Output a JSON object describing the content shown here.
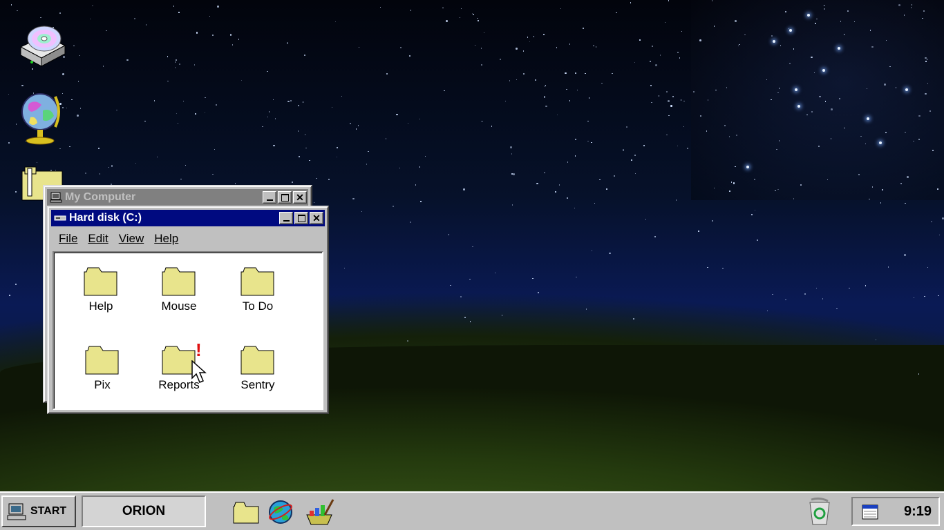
{
  "desktop": {
    "icons": [
      "cd-drive-icon",
      "internet-globe-icon",
      "documents-icon"
    ]
  },
  "windows": {
    "my_computer": {
      "title": "My Computer"
    },
    "hard_disk": {
      "title": "Hard disk (C:)",
      "menu": [
        {
          "label": "File"
        },
        {
          "label": "Edit"
        },
        {
          "label": "View"
        },
        {
          "label": "Help"
        }
      ],
      "folders": [
        {
          "label": "Help"
        },
        {
          "label": "Mouse"
        },
        {
          "label": "To Do"
        },
        {
          "label": "Pix"
        },
        {
          "label": "Reports",
          "badge": "!"
        },
        {
          "label": "Sentry"
        }
      ]
    }
  },
  "taskbar": {
    "start_label": "START",
    "task_label": "ORION",
    "quick_launch": [
      "folder-icon",
      "browser-globe-icon",
      "paint-icon"
    ],
    "clock": "9:19"
  },
  "colors": {
    "active_title": "#000a80",
    "inactive_title": "#808080",
    "folder_yellow": "#e8e48c",
    "chrome": "#c0c0c0"
  }
}
